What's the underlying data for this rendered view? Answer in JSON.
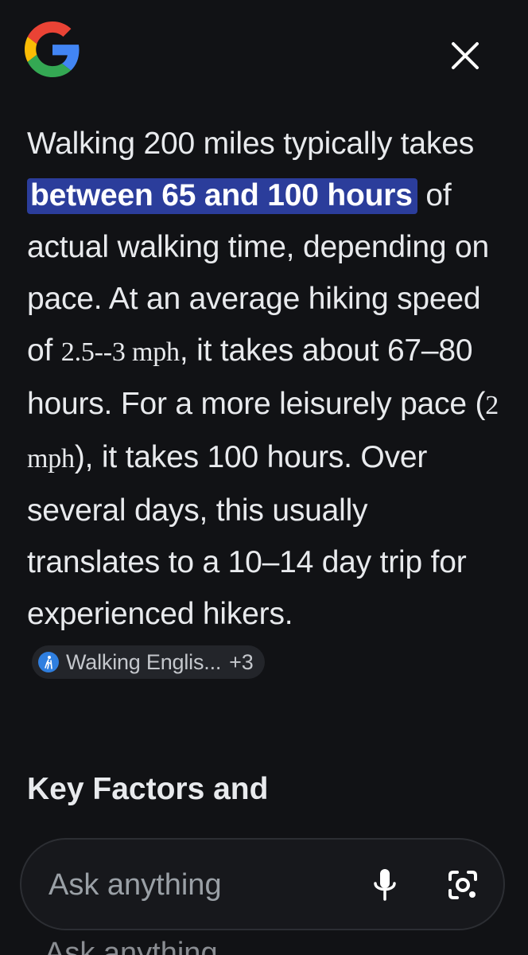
{
  "header": {
    "logo_icon": "google-g-icon",
    "close_icon": "close-icon"
  },
  "answer": {
    "p1": "Walking 200 miles typically takes ",
    "highlight": "between 65 and 100 hours",
    "p2": " of actual walking time, depending on pace. At an average hiking speed of ",
    "math1": "2.5--3 mph",
    "p3": ", it takes about 67–80 hours. For a more leisurely pace (",
    "math2": "2 mph",
    "p4": "), it takes 100 hours. Over several days, this usually translates to a 10–14 day trip for experienced hikers.",
    "source_chip": {
      "icon": "hiker-icon",
      "label": "Walking Englis...",
      "extra": "+3"
    }
  },
  "section": {
    "heading": "Key Factors and"
  },
  "ask_bar": {
    "placeholder": "Ask anything",
    "mic_icon": "microphone-icon",
    "lens_icon": "camera-lens-icon"
  },
  "ghost": {
    "text": "Ask anything"
  },
  "colors": {
    "background": "#111215",
    "highlight": "#2b3d9b",
    "chip_icon": "#2f7fe0"
  }
}
